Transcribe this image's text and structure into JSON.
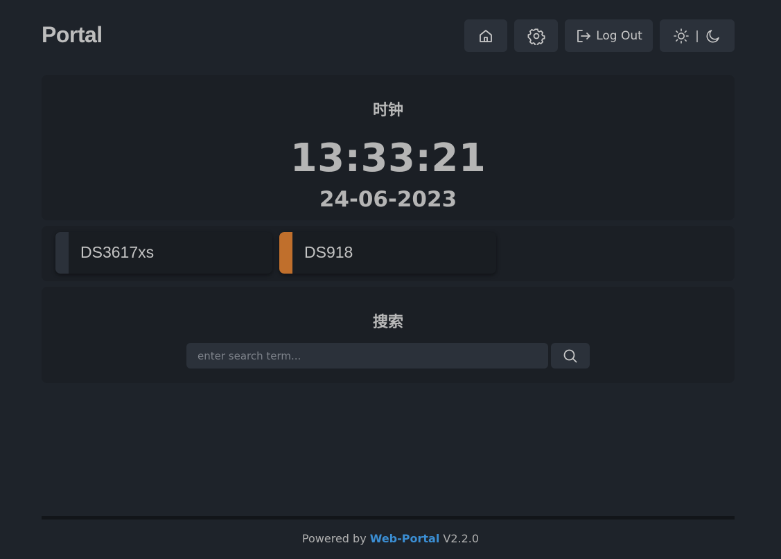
{
  "header": {
    "logo": "Portal",
    "logout_label": "Log Out",
    "theme_separator": "|"
  },
  "clock": {
    "title": "时钟",
    "time": "13:33:21",
    "date": "24-06-2023"
  },
  "apps": [
    {
      "name": "DS3617xs",
      "color": "#2b313a"
    },
    {
      "name": "DS918",
      "color": "#c06f2c"
    }
  ],
  "search": {
    "title": "搜索",
    "placeholder": "enter search term..."
  },
  "footer": {
    "prefix": "Powered by ",
    "link": "Web-Portal",
    "version": " V2.2.0"
  },
  "icons": {
    "home": "home-icon",
    "settings": "gear-icon",
    "logout": "logout-icon",
    "sun": "sun-icon",
    "moon": "moon-icon",
    "search": "search-icon"
  },
  "colors": {
    "background": "#1e232a",
    "card": "#1b1f25",
    "button": "#2b313a",
    "accent_link": "#3b8ed3",
    "app_orange": "#c06f2c"
  }
}
